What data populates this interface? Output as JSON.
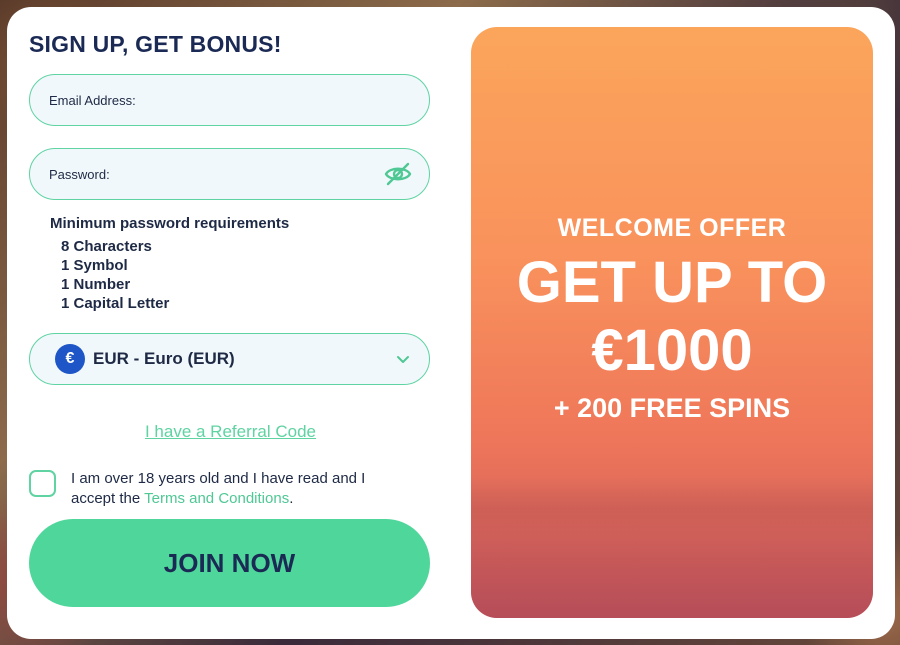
{
  "form": {
    "title": "SIGN UP, GET BONUS!",
    "email_placeholder": "Email Address:",
    "password_placeholder": "Password:",
    "requirements_title": "Minimum password requirements",
    "requirements": [
      "8 Characters",
      "1 Symbol",
      "1 Number",
      "1 Capital Letter"
    ],
    "currency_symbol": "€",
    "currency_label": "EUR - Euro (EUR)",
    "referral_link": "I have a Referral Code",
    "terms_text": "I am over 18 years old and I have read and I accept the ",
    "terms_link": "Terms and Conditions",
    "terms_end": ".",
    "join_button": "JOIN NOW",
    "checkbox_checked": false
  },
  "promo": {
    "offer_label": "WELCOME OFFER",
    "headline_line1": "GET UP TO",
    "headline_line2": "€1000",
    "spins": "+ 200 FREE SPINS"
  },
  "colors": {
    "accent": "#4fd69a",
    "text_dark": "#1b2a55",
    "euro_badge": "#1e56c8"
  },
  "icons": {
    "password_toggle": "eye-slash-icon",
    "currency": "euro-icon",
    "dropdown": "chevron-down-icon"
  }
}
